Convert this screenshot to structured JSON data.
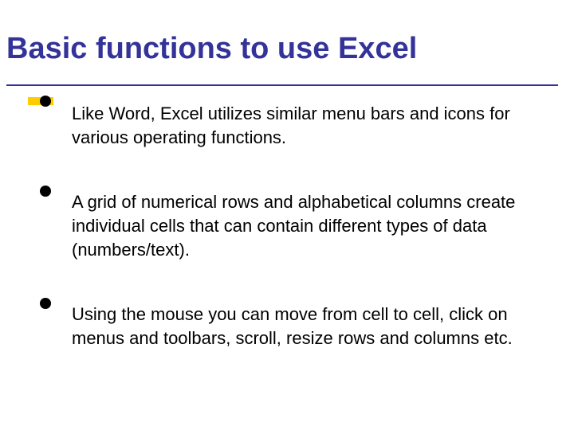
{
  "title": "Basic functions to use Excel",
  "bullets": [
    "Like Word, Excel utilizes similar menu bars and icons for various operating functions.",
    "A grid of numerical rows and alphabetical columns create individual cells that can contain different types of data (numbers/text).",
    "Using the mouse you can move from cell to cell, click on menus and toolbars, scroll, resize rows and columns etc."
  ]
}
